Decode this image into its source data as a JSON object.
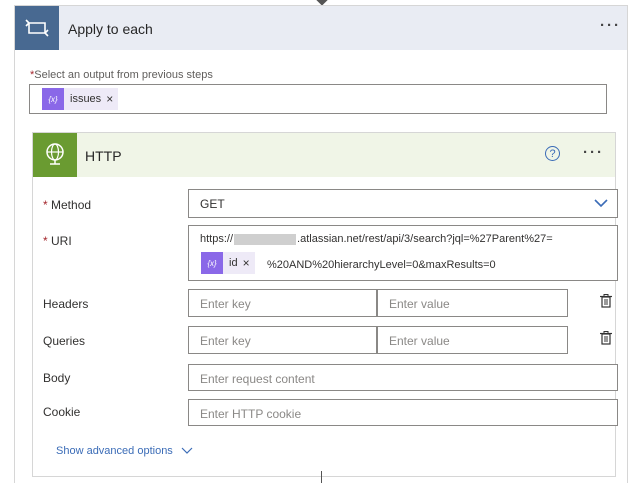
{
  "loop": {
    "title": "Apply to each",
    "more_label": "···",
    "select_label": "Select an output from previous steps",
    "required_mark": "*",
    "token": {
      "icon_text": "{x}",
      "text": "issues",
      "remove": "×"
    }
  },
  "http": {
    "title": "HTTP",
    "help_label": "?",
    "more_label": "···",
    "method": {
      "label": "Method",
      "value": "GET"
    },
    "uri": {
      "label": "URI",
      "line1_prefix": "https://",
      "line1_suffix": ".atlassian.net/rest/api/3/search?jql=%27Parent%27=",
      "token": {
        "icon_text": "{x}",
        "text": "id",
        "remove": "×"
      },
      "line2": "%20AND%20hierarchyLevel=0&maxResults=0"
    },
    "headers": {
      "label": "Headers",
      "key_placeholder": "Enter key",
      "value_placeholder": "Enter value"
    },
    "queries": {
      "label": "Queries",
      "key_placeholder": "Enter key",
      "value_placeholder": "Enter value"
    },
    "body": {
      "label": "Body",
      "placeholder": "Enter request content"
    },
    "cookie": {
      "label": "Cookie",
      "placeholder": "Enter HTTP cookie"
    },
    "advanced_label": "Show advanced options"
  },
  "colors": {
    "loop_header_bg": "#e9ecf3",
    "loop_icon_bg": "#486991",
    "http_header_bg": "#f0f5e7",
    "http_icon_bg": "#6a9b31",
    "token_icon_bg": "#8a68e8",
    "link_blue": "#3b6cb7"
  },
  "icons": [
    "loop-icon",
    "globe-icon",
    "help-icon",
    "chevron-down-icon",
    "delete-icon"
  ]
}
